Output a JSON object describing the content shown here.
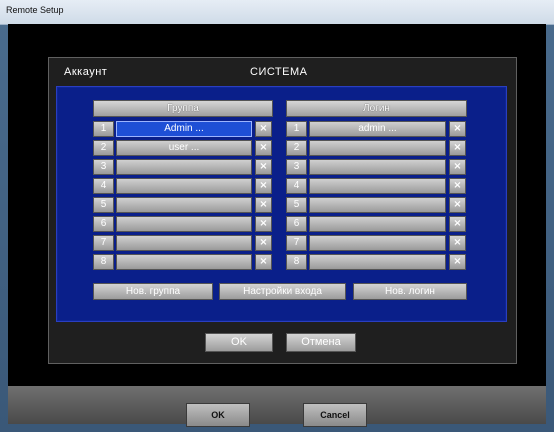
{
  "window": {
    "title": "Remote Setup"
  },
  "dialog": {
    "left_title": "Аккаунт",
    "center_title": "СИСТЕМА",
    "group_header": "Группа",
    "login_header": "Логин",
    "close_glyph": "×",
    "groups": [
      {
        "num": "1",
        "value": "Admin ..."
      },
      {
        "num": "2",
        "value": "user ..."
      },
      {
        "num": "3",
        "value": ""
      },
      {
        "num": "4",
        "value": ""
      },
      {
        "num": "5",
        "value": ""
      },
      {
        "num": "6",
        "value": ""
      },
      {
        "num": "7",
        "value": ""
      },
      {
        "num": "8",
        "value": ""
      }
    ],
    "logins": [
      {
        "num": "1",
        "value": "admin ..."
      },
      {
        "num": "2",
        "value": ""
      },
      {
        "num": "3",
        "value": ""
      },
      {
        "num": "4",
        "value": ""
      },
      {
        "num": "5",
        "value": ""
      },
      {
        "num": "6",
        "value": ""
      },
      {
        "num": "7",
        "value": ""
      },
      {
        "num": "8",
        "value": ""
      }
    ],
    "new_group": "Нов. группа",
    "login_settings": "Настройки входа",
    "new_login": "Нов. логин",
    "ok": "OK",
    "cancel": "Отмена"
  },
  "bottom": {
    "ok": "OK",
    "cancel": "Cancel"
  },
  "colors": {
    "panel": "#0a1f8a",
    "selected": "#1e4fd6",
    "dialog_bg": "#1f1f1f"
  },
  "icons": {
    "close": "close-icon"
  }
}
